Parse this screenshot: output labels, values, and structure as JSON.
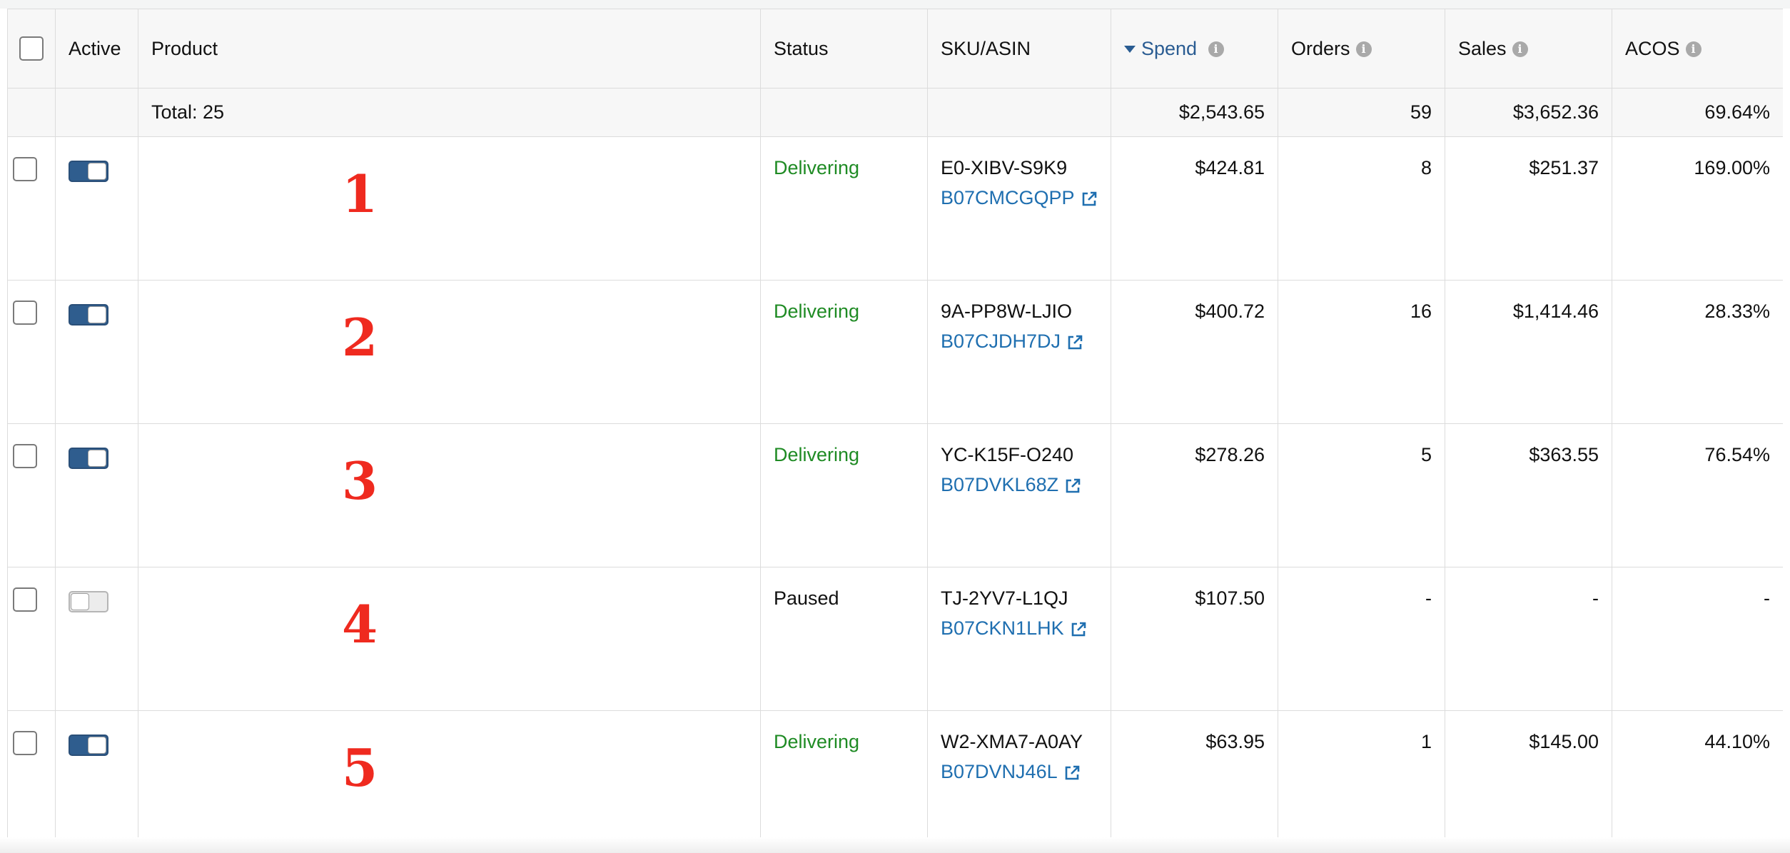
{
  "columns": {
    "active": "Active",
    "product": "Product",
    "status": "Status",
    "sku_asin": "SKU/ASIN",
    "spend": "Spend",
    "orders": "Orders",
    "sales": "Sales",
    "acos": "ACOS"
  },
  "sort": {
    "column": "spend",
    "direction": "descending",
    "icon": "sort-descending-icon"
  },
  "info_icon_glyph": "i",
  "totals": {
    "label": "Total: 25",
    "spend": "$2,543.65",
    "orders": "59",
    "sales": "$3,652.36",
    "acos": "69.64%"
  },
  "rows": [
    {
      "rank": "1",
      "active": true,
      "status": "Delivering",
      "sku": "E0-XIBV-S9K9",
      "asin": "B07CMCGQPP",
      "spend": "$424.81",
      "orders": "8",
      "sales": "$251.37",
      "acos": "169.00%"
    },
    {
      "rank": "2",
      "active": true,
      "status": "Delivering",
      "sku": "9A-PP8W-LJIO",
      "asin": "B07CJDH7DJ",
      "spend": "$400.72",
      "orders": "16",
      "sales": "$1,414.46",
      "acos": "28.33%"
    },
    {
      "rank": "3",
      "active": true,
      "status": "Delivering",
      "sku": "YC-K15F-O240",
      "asin": "B07DVKL68Z",
      "spend": "$278.26",
      "orders": "5",
      "sales": "$363.55",
      "acos": "76.54%"
    },
    {
      "rank": "4",
      "active": false,
      "status": "Paused",
      "sku": "TJ-2YV7-L1QJ",
      "asin": "B07CKN1LHK",
      "spend": "$107.50",
      "orders": "-",
      "sales": "-",
      "acos": "-"
    },
    {
      "rank": "5",
      "active": true,
      "status": "Delivering",
      "sku": "W2-XMA7-A0AY",
      "asin": "B07DVNJ46L",
      "spend": "$63.95",
      "orders": "1",
      "sales": "$145.00",
      "acos": "44.10%"
    }
  ],
  "colors": {
    "delivering": "#1f8b24",
    "link": "#1f6fb0",
    "toggle_on": "#2f5d8e",
    "rank_number": "#ef2a1f",
    "sort_accent": "#2a5c92"
  }
}
